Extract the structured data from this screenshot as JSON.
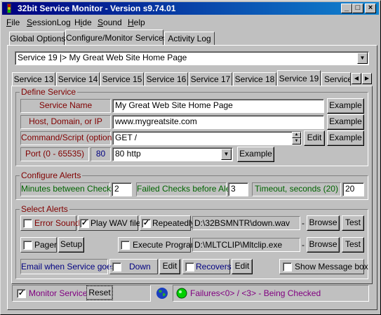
{
  "window": {
    "title": "32bit Service Monitor - Version s9.74.01"
  },
  "menu": [
    {
      "label": "File",
      "u": "F",
      "rest": "ile"
    },
    {
      "label": "SessionLog",
      "u": "S",
      "rest": "essionLog"
    },
    {
      "label": "Hide",
      "pre": "H",
      "u": "i",
      "rest": "de"
    },
    {
      "label": "Sound",
      "u": "S",
      "rest": "ound"
    },
    {
      "label": "Help",
      "u": "H",
      "rest": "elp"
    }
  ],
  "top_tabs": [
    "Global Options",
    "Configure/Monitor Services",
    "Activity Log"
  ],
  "service_select": "Service 19 |> My Great Web Site Home Page",
  "service_tabs": [
    "Service 13",
    "Service 14",
    "Service 15",
    "Service 16",
    "Service 17",
    "Service 18",
    "Service 19",
    "Service"
  ],
  "define": {
    "title": "Define Service",
    "name_label": "Service Name",
    "name_value": "My Great Web Site Home Page",
    "host_label": "Host, Domain, or IP",
    "host_value": "www.mygreatsite.com",
    "cmd_label": "Command/Script (optional)",
    "cmd_value": "GET /",
    "edit": "Edit",
    "port_label": "Port (0 - 65535)",
    "port_value": "80",
    "port_select": "80 http",
    "example": "Example"
  },
  "alerts": {
    "title": "Configure Alerts",
    "minutes_label": "Minutes between Checks",
    "minutes_value": "2",
    "failed_label": "Failed Checks before Alert",
    "failed_value": "3",
    "timeout_label": "Timeout, seconds (20)",
    "timeout_value": "20"
  },
  "select_alerts": {
    "title": "Select Alerts",
    "error_sound": "Error Sound",
    "play_wav": "Play WAV file",
    "repeatedly": "Repeatedly",
    "wav_path": "D:\\32BSMNTR\\down.wav",
    "browse": "Browse",
    "test": "Test",
    "pager": "Pager",
    "setup": "Setup",
    "execute": "Execute Program",
    "exe_path": "D:\\MLTCLIP\\Mltclip.exe",
    "email_label": "Email when Service goes",
    "down": "Down",
    "edit": "Edit",
    "recovers": "Recovers",
    "show_message": "Show Message box",
    "dash": "-"
  },
  "status": {
    "monitor": "Monitor Service",
    "reset": "Reset",
    "failures": "Failures<0> / <3> - Being Checked"
  },
  "colors": {
    "title_start": "#000080",
    "title_end": "#1084d0",
    "label_red": "#800000",
    "label_green": "#006400",
    "status_purple": "#800080"
  }
}
